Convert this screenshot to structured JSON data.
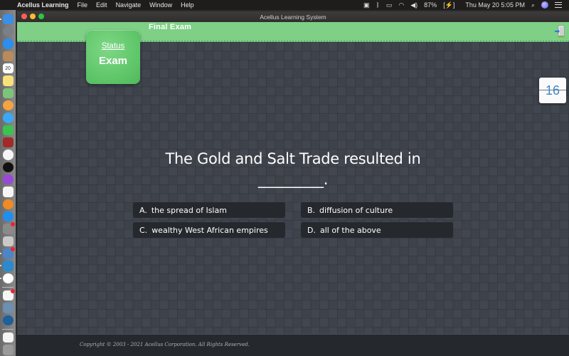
{
  "menubar": {
    "app_name": "Acellus Learning",
    "menus": [
      "File",
      "Edit",
      "Navigate",
      "Window",
      "Help"
    ],
    "status": {
      "battery": "87%",
      "datetime": "Thu May 20  5:05 PM"
    },
    "icons": [
      "screen-record-icon",
      "bluetooth-icon",
      "airplay-icon",
      "wifi-icon",
      "volume-icon",
      "battery-icon",
      "search-icon",
      "siri-icon",
      "control-center-icon"
    ]
  },
  "dock": {
    "apps": [
      {
        "name": "finder",
        "color": "#3b8fe6"
      },
      {
        "name": "launchpad",
        "color": "#7a7f88"
      },
      {
        "name": "safari",
        "color": "#2b8ef0"
      },
      {
        "name": "contacts",
        "color": "#b98b5a"
      },
      {
        "name": "calendar",
        "color": "#ffffff",
        "text": "20"
      },
      {
        "name": "notes",
        "color": "#f7e27a"
      },
      {
        "name": "maps",
        "color": "#7cc47a"
      },
      {
        "name": "photos",
        "color": "#f4a340"
      },
      {
        "name": "messages",
        "color": "#3aa8f5"
      },
      {
        "name": "facetime",
        "color": "#3bc24f"
      },
      {
        "name": "photo-booth",
        "color": "#a12a2a"
      },
      {
        "name": "music",
        "color": "#f5f5f5"
      },
      {
        "name": "apple-tv",
        "color": "#111111"
      },
      {
        "name": "podcasts",
        "color": "#9b48d9"
      },
      {
        "name": "news",
        "color": "#f5f5f5"
      },
      {
        "name": "books",
        "color": "#f08a24"
      },
      {
        "name": "app-store",
        "color": "#1e8ff2"
      },
      {
        "name": "system-preferences",
        "color": "#8a8a8a"
      },
      {
        "name": "blank-app",
        "color": "#c9c9c9"
      },
      {
        "name": "preview",
        "color": "#4b86c9"
      },
      {
        "name": "acellus",
        "color": "#2a8ad0"
      },
      {
        "name": "chrome",
        "color": "#ffffff"
      },
      {
        "name": "reminders",
        "color": "#f5f5f5"
      },
      {
        "name": "image-capture",
        "color": "#6d8fb0"
      },
      {
        "name": "quicktime",
        "color": "#1e5f9c"
      },
      {
        "name": "document",
        "color": "#f5f5f5"
      },
      {
        "name": "trash",
        "color": "#9a9a9a"
      }
    ]
  },
  "window": {
    "title": "Acellus Learning System",
    "header_title": "Final Exam",
    "status_card": {
      "label": "Status",
      "value": "Exam"
    },
    "page_counter": "16",
    "question": {
      "text": "The Gold and Salt Trade resulted in",
      "blank": "_________."
    },
    "answers": [
      {
        "letter": "A.",
        "text": "the spread of Islam"
      },
      {
        "letter": "B.",
        "text": "diffusion of culture"
      },
      {
        "letter": "C.",
        "text": "wealthy West African empires"
      },
      {
        "letter": "D.",
        "text": "all of the above"
      }
    ],
    "footer": {
      "copyright": "Copyright © 2003 - 2021 Acellus Corporation.  All Rights Reserved."
    }
  },
  "colors": {
    "header_green": "#7fcf87",
    "status_green": "#5cc466",
    "background": "#3d424b",
    "answer_bg": "#25282d",
    "footer_bg": "#25292d",
    "counter_blue": "#3d86c8"
  }
}
